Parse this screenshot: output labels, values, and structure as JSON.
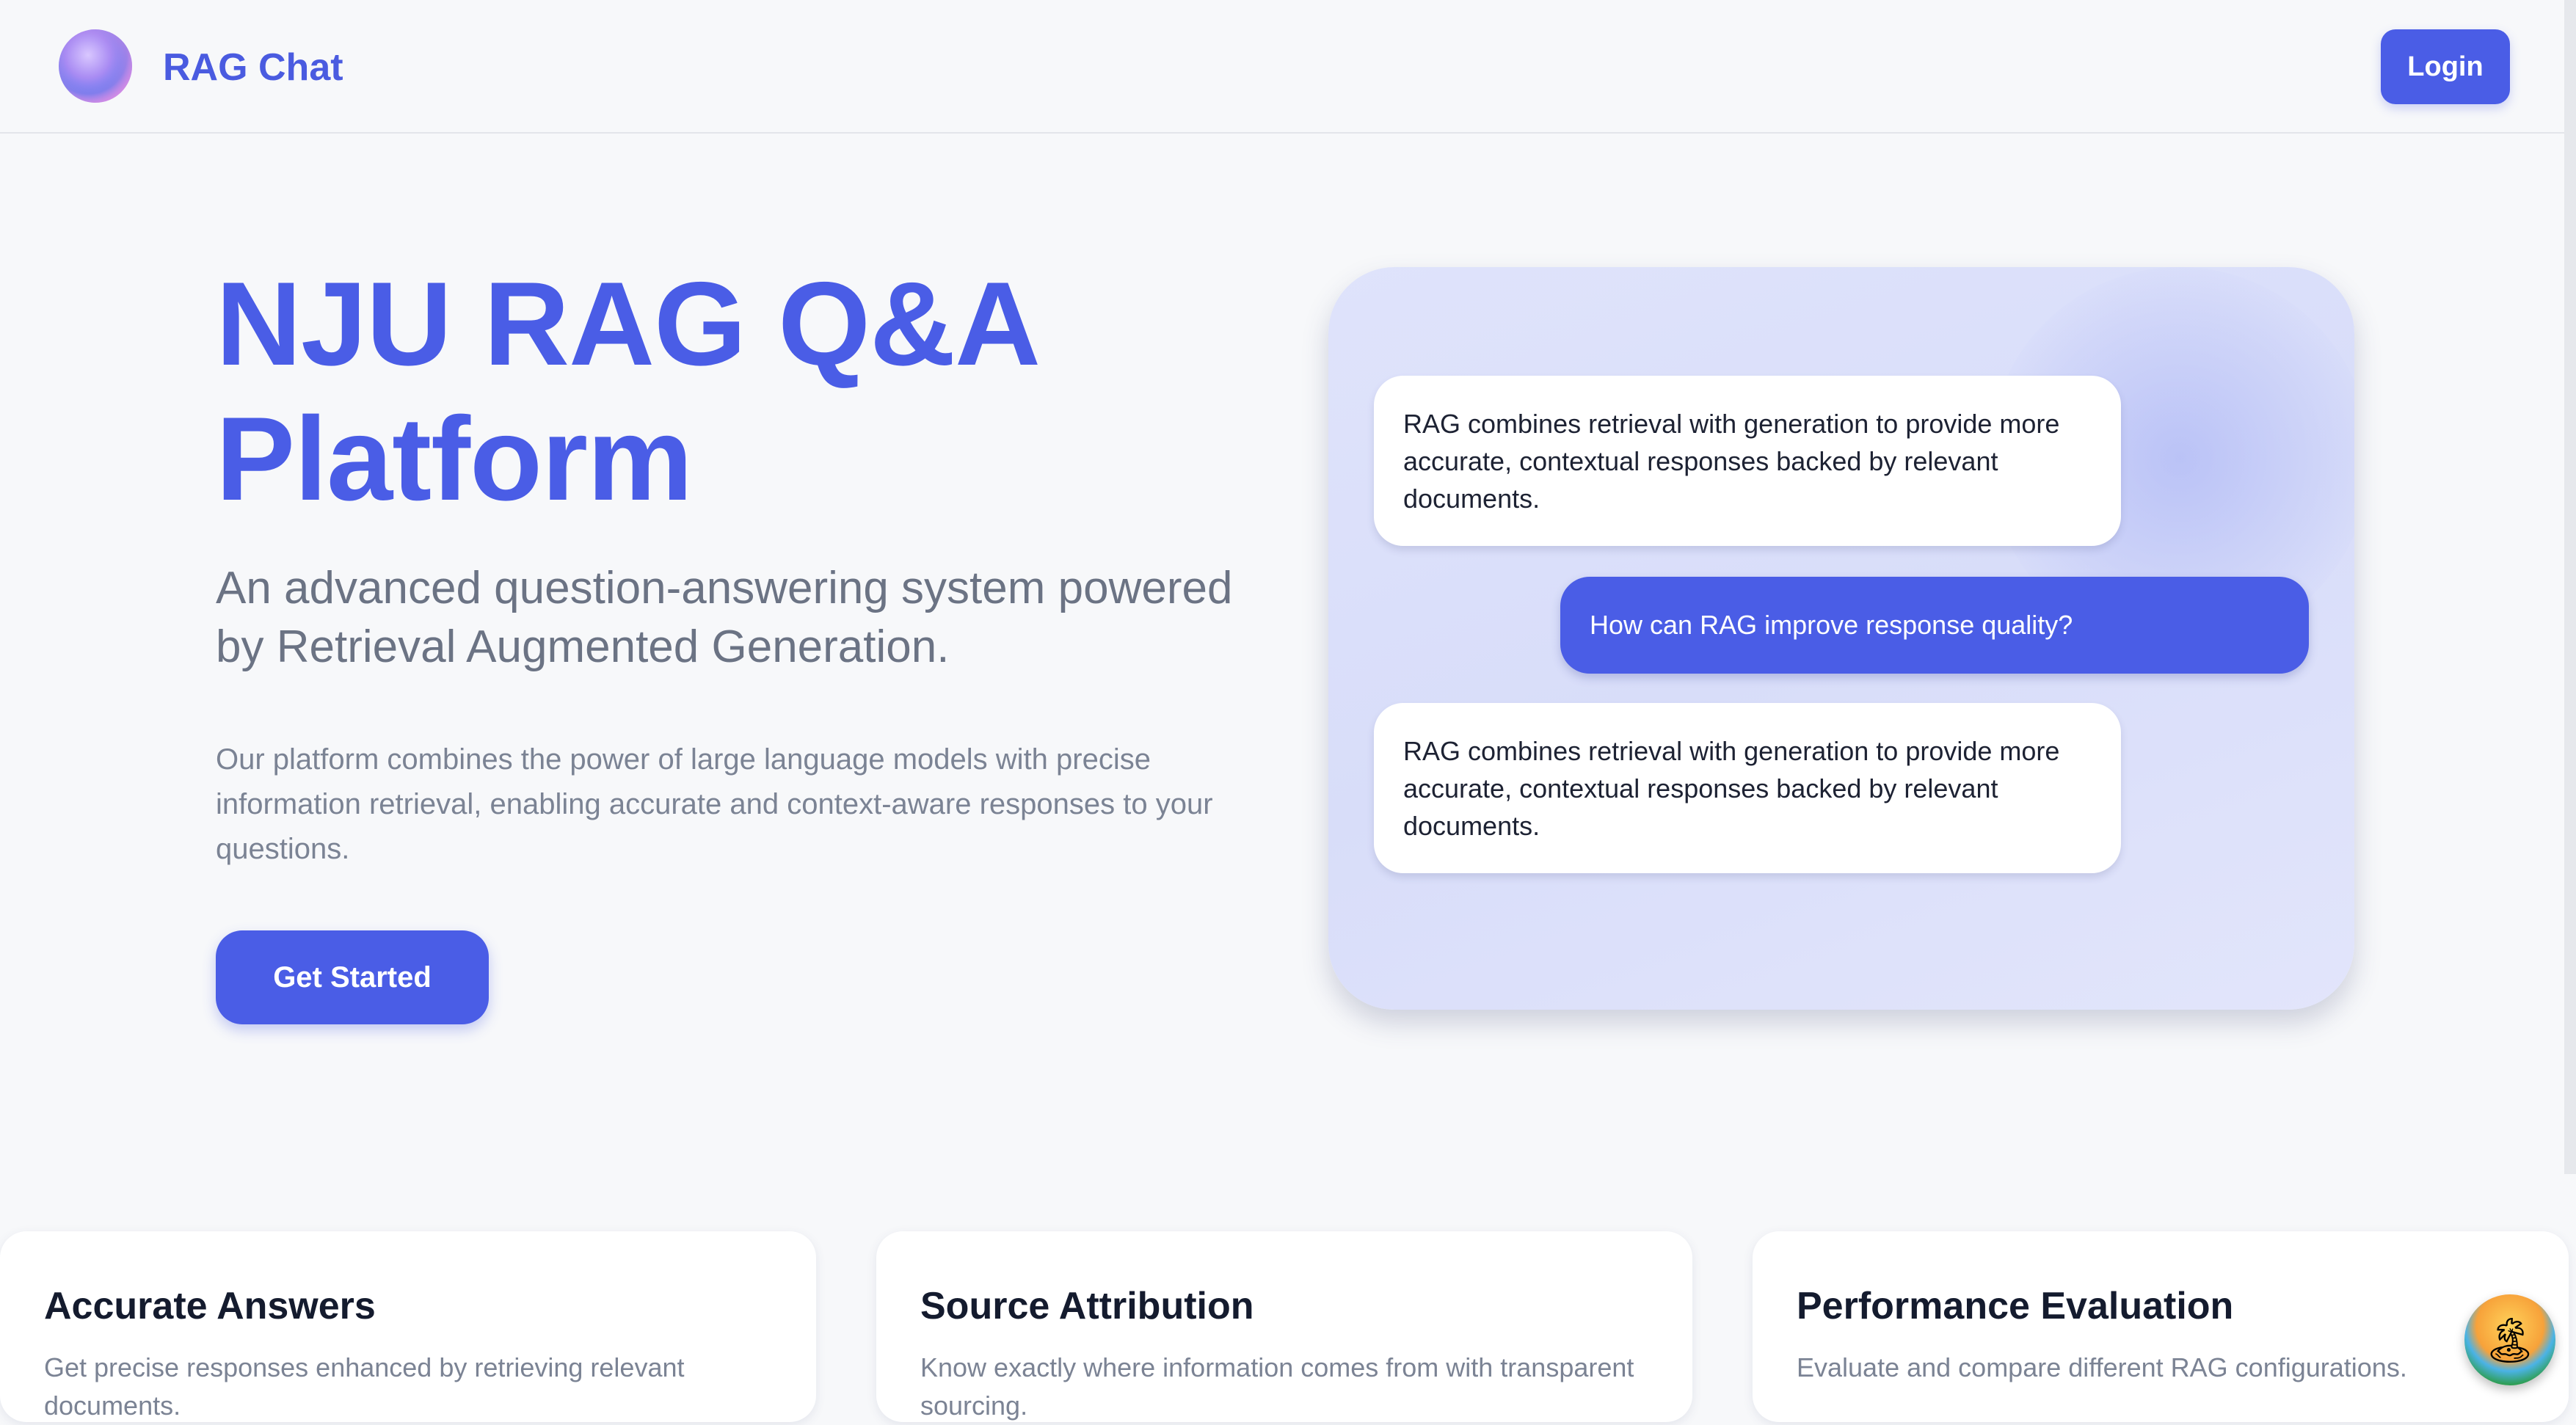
{
  "header": {
    "brand": "RAG Chat",
    "login_label": "Login"
  },
  "hero": {
    "title": "NJU RAG Q&A Platform",
    "subtitle": "An advanced question-answering system powered by Retrieval Augmented Generation.",
    "description": "Our platform combines the power of large language models with precise information retrieval, enabling accurate and context-aware responses to your questions.",
    "cta_label": "Get Started"
  },
  "chat": {
    "messages": [
      {
        "role": "bot",
        "text": "RAG combines retrieval with generation to provide more accurate, contextual responses backed by relevant documents."
      },
      {
        "role": "user",
        "text": "How can RAG improve response quality?"
      },
      {
        "role": "bot",
        "text": "RAG combines retrieval with generation to provide more accurate, contextual responses backed by relevant documents."
      }
    ]
  },
  "features": [
    {
      "title": "Accurate Answers",
      "text": "Get precise responses enhanced by retrieving relevant documents."
    },
    {
      "title": "Source Attribution",
      "text": "Know exactly where information comes from with transparent sourcing."
    },
    {
      "title": "Performance Evaluation",
      "text": "Evaluate and compare different RAG configurations."
    }
  ],
  "icons": {
    "logo": "orb-logo-icon",
    "floating": "island-icon"
  },
  "colors": {
    "accent": "#4a5de6",
    "background": "#f7f8fa"
  }
}
